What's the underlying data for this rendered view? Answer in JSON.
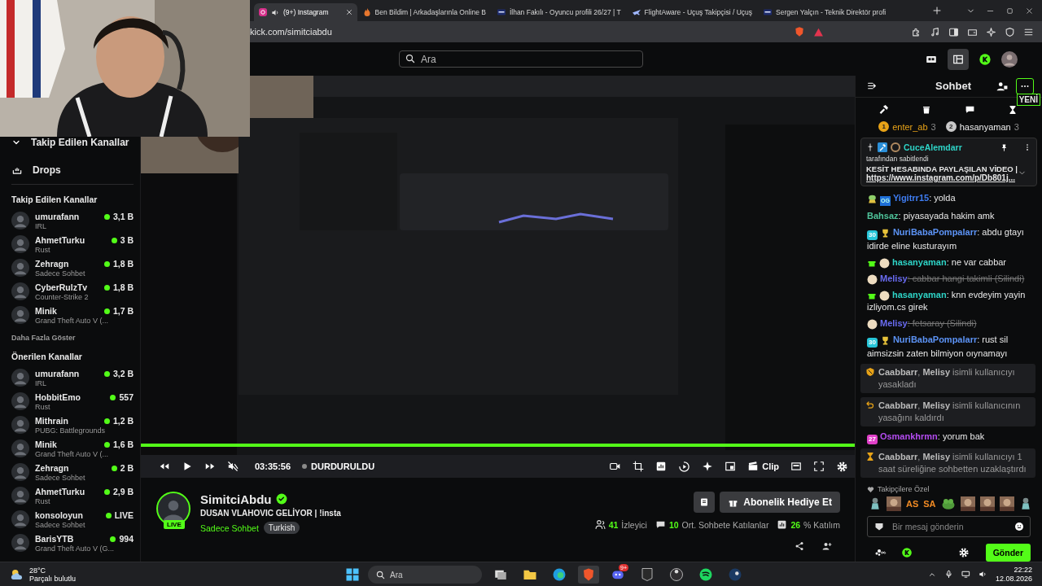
{
  "browser": {
    "tabs": [
      {
        "title": "(9+) Instagram",
        "kind": "camera",
        "audio": true,
        "selected": true
      },
      {
        "title": "Ben Bildim | Arkadaşlarınla Online B",
        "kind": "flame",
        "audio": false,
        "selected": false
      },
      {
        "title": "İlhan Fakılı - Oyuncu profili 26/27 | T",
        "kind": "square",
        "audio": false,
        "selected": false
      },
      {
        "title": "FlightAware - Uçuş Takipçisi / Uçuş",
        "kind": "plane",
        "audio": false,
        "selected": false
      },
      {
        "title": "Sergen Yalçın - Teknik Direktör profi",
        "kind": "square",
        "audio": false,
        "selected": false
      }
    ],
    "address": "kick.com/simitciabdu"
  },
  "header": {
    "search_placeholder": "Ara"
  },
  "sidebar": {
    "top_items": [
      {
        "kind": "collapse",
        "label": "Takip Edilen Kanallar"
      },
      {
        "kind": "drops",
        "label": "Drops"
      }
    ],
    "sections": [
      {
        "title": "Takip Edilen Kanallar",
        "more": "Daha Fazla Göster",
        "channels": [
          {
            "name": "umurafann",
            "category": "IRL",
            "viewers": "3,1 B"
          },
          {
            "name": "AhmetTurku",
            "category": "Rust",
            "viewers": "3 B"
          },
          {
            "name": "Zehragn",
            "category": "Sadece Sohbet",
            "viewers": "1,8 B"
          },
          {
            "name": "CyberRulzTv",
            "category": "Counter-Strike 2",
            "viewers": "1,8 B"
          },
          {
            "name": "Minik",
            "category": "Grand Theft Auto V (...",
            "viewers": "1,7 B"
          }
        ]
      },
      {
        "title": "Önerilen Kanallar",
        "channels": [
          {
            "name": "umurafann",
            "category": "IRL",
            "viewers": "3,2 B"
          },
          {
            "name": "HobbitEmo",
            "category": "Rust",
            "viewers": "557"
          },
          {
            "name": "Mithrain",
            "category": "PUBG: Battlegrounds",
            "viewers": "1,2 B"
          },
          {
            "name": "Minik",
            "category": "Grand Theft Auto V (...",
            "viewers": "1,6 B"
          },
          {
            "name": "Zehragn",
            "category": "Sadece Sohbet",
            "viewers": "2 B"
          },
          {
            "name": "AhmetTurku",
            "category": "Rust",
            "viewers": "2,9 B"
          },
          {
            "name": "konsoloyun",
            "category": "Sadece Sohbet",
            "viewers": "LIVE"
          },
          {
            "name": "BarisYTB",
            "category": "Grand Theft Auto V (G...",
            "viewers": "994"
          }
        ]
      }
    ]
  },
  "player": {
    "paused": true,
    "muted": true,
    "time": "03:35:56",
    "status": "DURDURULDU",
    "clip": "Clip"
  },
  "stream": {
    "channel": "SimitciAbdu",
    "verified": true,
    "live_badge": "LIVE",
    "title": "DUSAN VLAHOVIC GELİYOR | !insta",
    "category": "Sadece Sohbet",
    "tags": [
      "Turkish"
    ],
    "gift_button": "Abonelik Hediye Et",
    "stats": [
      {
        "kind": "viewers",
        "value": "41",
        "label": "İzleyici"
      },
      {
        "kind": "chatters",
        "value": "10",
        "label": "Ort. Sohbete Katılanlar"
      },
      {
        "kind": "engagement",
        "value": "26",
        "label": "% Katılım"
      }
    ]
  },
  "chat": {
    "title": "Sohbet",
    "new_badge": "YENİ",
    "leaders": [
      {
        "rank": "1",
        "name": "enter_ab",
        "count": "3",
        "color": "#e8a317"
      },
      {
        "rank": "2",
        "name": "hasanyaman",
        "count": "3",
        "color": "#c8c8c8"
      }
    ],
    "pinned": {
      "user": "CuceAlemdarr",
      "note": "tarafından sabitlendi",
      "text": "KESİT HESABINDA PAYLAŞILAN VİDEO |",
      "link": "https://www.instagram.com/p/Db801j..."
    },
    "messages": [
      {
        "kind": "message",
        "badges": [
          {
            "kind": "alien"
          },
          {
            "kind": "og",
            "label": "OG"
          }
        ],
        "user": "Yigitrr15",
        "color": "#3f7cf0",
        "text": ": yolda",
        "deleted": false
      },
      {
        "kind": "message",
        "user": "Bahsaz",
        "color": "#4fc39a",
        "text": ": piyasayada hakim amk",
        "deleted": false
      },
      {
        "kind": "message",
        "badges": [
          {
            "kind": "sub",
            "label": "30",
            "color": "#27c5d8"
          },
          {
            "kind": "emoji"
          }
        ],
        "user": "NuriBabaPompalarr",
        "color": "#5c93f5",
        "text": ": abdu gtayı idirde eline kusturayım",
        "deleted": false
      },
      {
        "kind": "message",
        "badges": [
          {
            "kind": "gift"
          },
          {
            "kind": "avatar"
          }
        ],
        "user": "hasanyaman",
        "color": "#2ed3c6",
        "text": ": ne var cabbar",
        "deleted": false
      },
      {
        "kind": "message",
        "badges": [
          {
            "kind": "avatar"
          }
        ],
        "user": "Melisy",
        "color": "#6a6cf2",
        "text": ": cabbar hangi takimli (Silindi)",
        "deleted": true
      },
      {
        "kind": "message",
        "badges": [
          {
            "kind": "gift"
          },
          {
            "kind": "avatar"
          }
        ],
        "user": "hasanyaman",
        "color": "#2ed3c6",
        "text": ": knn evdeyim yayin izliyom.cs girek",
        "deleted": false
      },
      {
        "kind": "message",
        "badges": [
          {
            "kind": "avatar"
          }
        ],
        "user": "Melisy",
        "color": "#6a6cf2",
        "text": ": fetsaray (Silindi)",
        "deleted": true
      },
      {
        "kind": "message",
        "badges": [
          {
            "kind": "sub",
            "label": "30",
            "color": "#27c5d8"
          },
          {
            "kind": "emoji"
          }
        ],
        "user": "NuriBabaPompalarr",
        "color": "#5c93f5",
        "text": ": rust sil aimsizsin zaten bilmiyon oıynamayı",
        "deleted": false
      },
      {
        "kind": "ban",
        "text": "**Caabbarr**, **Melisy** isimli kullanıcıyı yasakladı"
      },
      {
        "kind": "unban",
        "text": "**Caabbarr**, **Melisy** isimli kullanıcının yasağını kaldırdı"
      },
      {
        "kind": "message",
        "badges": [
          {
            "kind": "sub",
            "label": "27",
            "color": "#e040c8"
          }
        ],
        "user": "Osmankhrmn",
        "color": "#b44cf0",
        "text": ": yorum bak",
        "deleted": false
      },
      {
        "kind": "timeout",
        "text": "**Caabbarr**, **Melisy** isimli kullanıcıyı 1 saat süreliğine sohbetten uzaklaştırdı"
      }
    ],
    "emote_label": "Takipçilere Özel",
    "emotes": [
      {
        "kind": "figure"
      },
      {
        "kind": "picture"
      },
      {
        "kind": "text",
        "text": "AS"
      },
      {
        "kind": "text",
        "text": "SA"
      },
      {
        "kind": "frog"
      },
      {
        "kind": "picture"
      },
      {
        "kind": "picture"
      },
      {
        "kind": "picture"
      },
      {
        "kind": "figure"
      }
    ],
    "input_placeholder": "Bir mesaj gönderin",
    "send": "Gönder"
  },
  "taskbar": {
    "temperature": "28°C",
    "weather": "Parçalı bulutlu",
    "search_placeholder": "Ara",
    "apps": [
      {
        "kind": "files",
        "active": false
      },
      {
        "kind": "folder",
        "active": false
      },
      {
        "kind": "edge",
        "active": false
      },
      {
        "kind": "brave",
        "active": true
      },
      {
        "kind": "discord",
        "badge": "9+",
        "active": false
      },
      {
        "kind": "epic",
        "active": false
      },
      {
        "kind": "obs",
        "active": false
      },
      {
        "kind": "spotify",
        "active": false
      },
      {
        "kind": "steam",
        "active": false
      }
    ],
    "time": "22:22",
    "date": "12.08.2026"
  }
}
